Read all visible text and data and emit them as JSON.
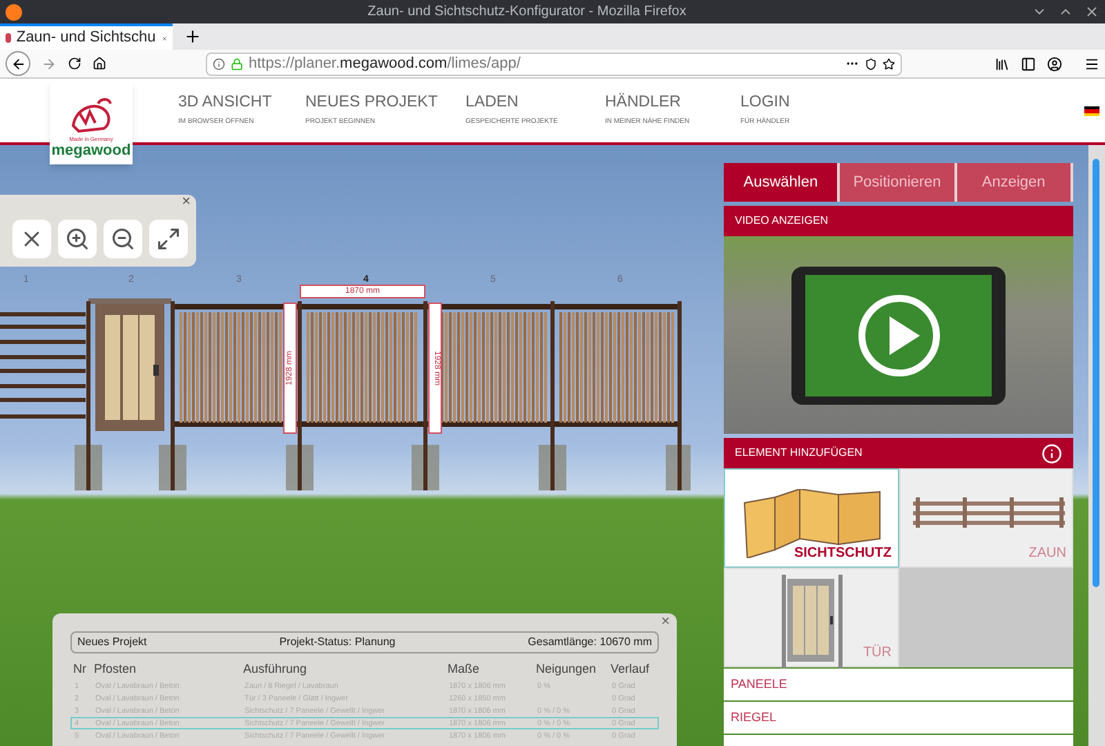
{
  "window": {
    "title": "Zaun- und Sichtschutz-Konfigurator - Mozilla Firefox"
  },
  "tabs": [
    {
      "label": "Zaun- und Sichtschu",
      "selected": true
    }
  ],
  "url": {
    "prefix": "https://planer.",
    "domain": "megawood.com",
    "path": "/limes/app/"
  },
  "logo": {
    "tagline": "Made in Germany",
    "name": "megawood"
  },
  "nav": [
    {
      "title": "3D ANSICHT",
      "subtitle": "IM BROWSER ÖFFNEN"
    },
    {
      "title": "NEUES PROJEKT",
      "subtitle": "PROJEKT BEGINNEN"
    },
    {
      "title": "LADEN",
      "subtitle": "GESPEICHERTE PROJEKTE"
    },
    {
      "title": "HÄNDLER",
      "subtitle": "IN MEINER NÄHE FINDEN"
    },
    {
      "title": "LOGIN",
      "subtitle": "FÜR HÄNDLER"
    }
  ],
  "toolbar": {
    "close": "×"
  },
  "scene": {
    "segments": [
      {
        "label": "1",
        "selected": false
      },
      {
        "label": "2",
        "selected": false
      },
      {
        "label": "3",
        "selected": false
      },
      {
        "label": "4",
        "selected": true
      },
      {
        "label": "5",
        "selected": false
      },
      {
        "label": "6",
        "selected": false
      }
    ],
    "width_label": "1870 mm",
    "height_labels": [
      "1928 mm",
      "1928 mm"
    ]
  },
  "steps": [
    {
      "label": "Auswählen",
      "selected": true
    },
    {
      "label": "Positionieren",
      "selected": false
    },
    {
      "label": "Anzeigen",
      "selected": false
    }
  ],
  "video": {
    "header": "VIDEO ANZEIGEN"
  },
  "elements": {
    "header": "ELEMENT HINZUFÜGEN",
    "items": [
      {
        "label": "SICHTSCHUTZ",
        "kind": "privacy",
        "selected": true
      },
      {
        "label": "ZAUN",
        "kind": "fence",
        "selected": false
      },
      {
        "label": "TÜR",
        "kind": "door",
        "selected": false
      }
    ]
  },
  "parts": [
    "PANEELE",
    "RIEGEL"
  ],
  "project": {
    "close": "×",
    "name": "Neues Projekt",
    "status": "Projekt-Status: Planung",
    "length": "Gesamtlänge: 10670 mm",
    "columns": [
      "Nr",
      "Pfosten",
      "Ausführung",
      "Maße",
      "Neigungen",
      "Verlauf"
    ],
    "rows": [
      {
        "cells": [
          "1",
          "Oval / Lavabraun / Beton",
          "Zaun / 8 Riegel / Lavabraun",
          "1870 x 1806 mm",
          "0 %",
          "0 Grad"
        ],
        "selected": false
      },
      {
        "cells": [
          "2",
          "Oval / Lavabraun / Beton",
          "Tür / 3 Paneele / Glatt / Ingwer",
          "1260 x 1850 mm",
          "",
          "0 Grad"
        ],
        "selected": false
      },
      {
        "cells": [
          "3",
          "Oval / Lavabraun / Beton",
          "Sichtschutz / 7 Paneele / Gewellt / Ingwer",
          "1870 x 1806 mm",
          "0 % / 0 %",
          "0 Grad"
        ],
        "selected": false
      },
      {
        "cells": [
          "4",
          "Oval / Lavabraun / Beton",
          "Sichtschutz / 7 Paneele / Gewellt / Ingwer",
          "1870 x 1806 mm",
          "0 % / 0 %",
          "0 Grad"
        ],
        "selected": true
      },
      {
        "cells": [
          "5",
          "Oval / Lavabraun / Beton",
          "Sichtschutz / 7 Paneele / Gewellt / Ingwer",
          "1870 x 1806 mm",
          "0 % / 0 %",
          "0 Grad"
        ],
        "selected": false
      }
    ]
  }
}
